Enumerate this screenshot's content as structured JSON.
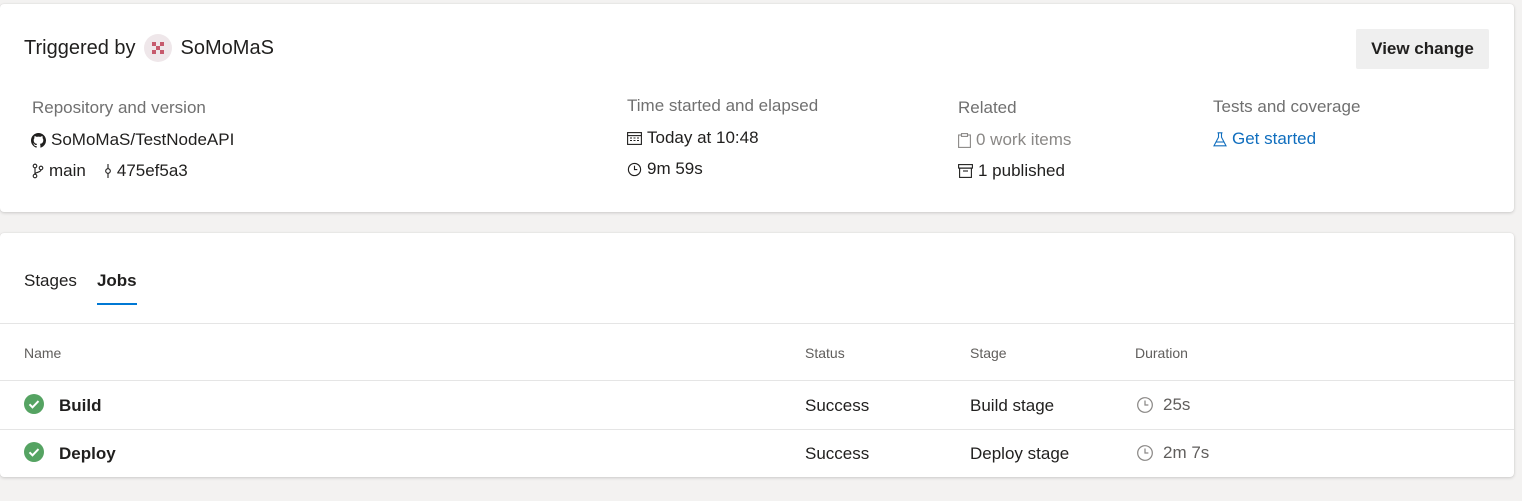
{
  "summary": {
    "triggered_prefix": "Triggered by",
    "triggered_user": "SoMoMaS",
    "view_change_label": "View change",
    "repository": {
      "heading": "Repository and version",
      "repo": "SoMoMaS/TestNodeAPI",
      "branch": "main",
      "commit": "475ef5a3"
    },
    "time": {
      "heading": "Time started and elapsed",
      "started": "Today at 10:48",
      "elapsed": "9m 59s"
    },
    "related": {
      "heading": "Related",
      "work_items": "0 work items",
      "published": "1 published"
    },
    "tests": {
      "heading": "Tests and coverage",
      "link": "Get started"
    }
  },
  "tabs": [
    {
      "label": "Stages",
      "active": false
    },
    {
      "label": "Jobs",
      "active": true
    }
  ],
  "table": {
    "columns": [
      "Name",
      "Status",
      "Stage",
      "Duration"
    ],
    "rows": [
      {
        "name": "Build",
        "status": "Success",
        "stage": "Build stage",
        "duration": "25s"
      },
      {
        "name": "Deploy",
        "status": "Success",
        "stage": "Deploy stage",
        "duration": "2m 7s"
      }
    ]
  },
  "colors": {
    "accent": "#0078d4",
    "link": "#106ebe",
    "success": "#55a362"
  },
  "icons": {
    "avatar": "user-avatar",
    "repo": "github-icon",
    "branch": "branch-icon",
    "commit": "commit-icon",
    "calendar": "calendar-icon",
    "clock": "clock-icon",
    "work_items": "clipboard-icon",
    "published": "artifact-icon",
    "tests": "flask-icon",
    "status": "success-check-icon"
  }
}
